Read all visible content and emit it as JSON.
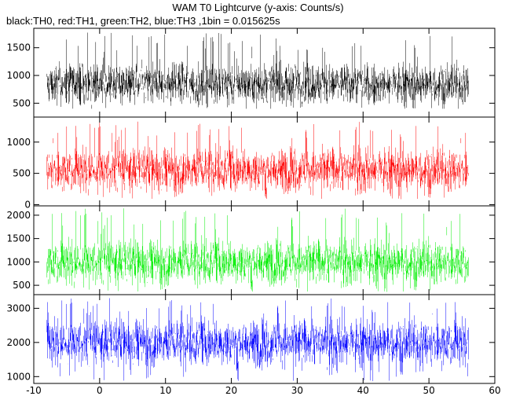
{
  "chart_data": {
    "type": "line",
    "title": "WAM T0 Lightcurve (y-axis: Counts/s)",
    "subtitle_parts": [
      {
        "text": "black:TH0, red:TH1, green:TH2, blue:TH3 ,1bin = 0.015625s"
      }
    ],
    "xlabel": "",
    "ylabel": "",
    "xlim": [
      -10,
      60
    ],
    "x_ticks": [
      -10,
      0,
      10,
      20,
      30,
      40,
      50,
      60
    ],
    "x_data_range": [
      -8,
      56
    ],
    "bin_seconds": 0.015625,
    "grid": false,
    "panels": [
      {
        "name": "TH0",
        "color": "#000000",
        "ylim": [
          250,
          1850
        ],
        "y_ticks": [
          500,
          1000,
          1500
        ],
        "mean": 850,
        "spread": 180,
        "min": 400,
        "max": 1800
      },
      {
        "name": "TH1",
        "color": "#ff0000",
        "ylim": [
          -20,
          1400
        ],
        "y_ticks": [
          0,
          500,
          1000
        ],
        "mean": 560,
        "spread": 170,
        "min": 80,
        "max": 1330
      },
      {
        "name": "TH2",
        "color": "#00ee00",
        "ylim": [
          300,
          2200
        ],
        "y_ticks": [
          500,
          1000,
          1500,
          2000
        ],
        "mean": 1000,
        "spread": 230,
        "min": 350,
        "max": 2150
      },
      {
        "name": "TH3",
        "color": "#0000ff",
        "ylim": [
          800,
          3400
        ],
        "y_ticks": [
          1000,
          2000,
          3000
        ],
        "mean": 2000,
        "spread": 330,
        "min": 850,
        "max": 3300
      }
    ]
  }
}
